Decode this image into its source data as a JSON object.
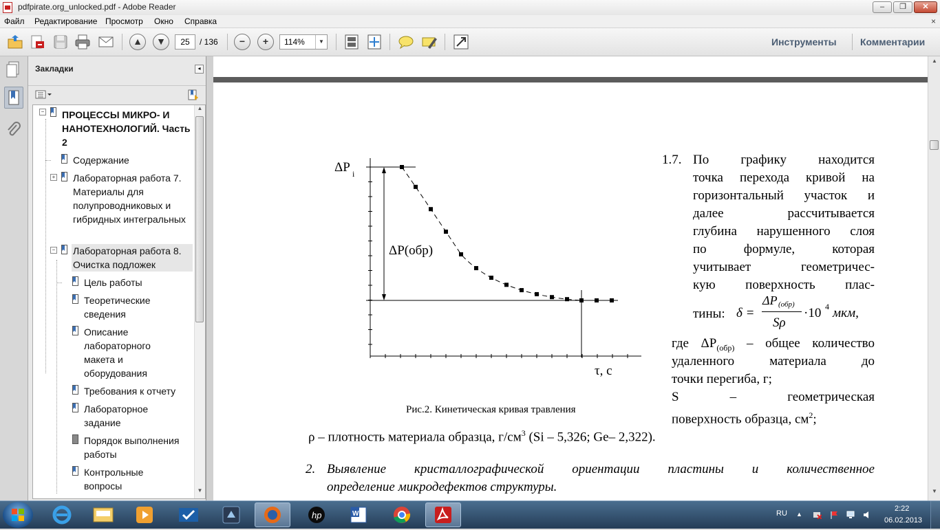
{
  "window": {
    "title": "pdfpirate.org_unlocked.pdf - Adobe Reader"
  },
  "menu": [
    "Файл",
    "Редактирование",
    "Просмотр",
    "Окно",
    "Справка"
  ],
  "toolbar": {
    "page_current": "25",
    "page_total": "/ 136",
    "zoom": "114%",
    "tools_label": "Инструменты",
    "comments_label": "Комментарии"
  },
  "bookmarks": {
    "title": "Закладки",
    "items": [
      {
        "label": "ПРОЦЕССЫ МИКРО- И НАНОТЕХНОЛОГИЙ. Часть 2"
      },
      {
        "label": "Содержание"
      },
      {
        "label": "Лабораторная работа 7. Материалы для полупроводниковых и гибридных интегральных"
      },
      {
        "label": "Лабораторная работа 8. Очистка подложек"
      },
      {
        "label": "Цель работы"
      },
      {
        "label": "Теоретические сведения"
      },
      {
        "label": "Описание лабораторного макета и оборудования"
      },
      {
        "label": "Требования к отчету"
      },
      {
        "label": "Лабораторное задание"
      },
      {
        "label": "Порядок выполнения работы"
      },
      {
        "label": "Контрольные вопросы"
      }
    ]
  },
  "document": {
    "figure": {
      "y_axis_label": "ΔP",
      "y_axis_sub": "i",
      "x_axis_label": "τ, с",
      "annotation": "ΔP(обр)",
      "caption": "Рис.2. Кинетическая кривая травления"
    },
    "item_17": {
      "number": "1.7.",
      "lines": [
        "По графику находится",
        "точка перехода кривой на",
        "горизонтальный участок и",
        "далее рассчитывается",
        "глубина нарушенного слоя",
        "по формуле, которая",
        "учитывает геометричес-",
        "кую поверхность плас-"
      ],
      "last_line_prefix": "тины:",
      "formula": {
        "lhs": "δ =",
        "numerator": "ΔP",
        "numerator_sub": "(обр)",
        "denominator": "Sρ",
        "factor": "·10",
        "exponent": "4",
        "unit": "мкм,"
      }
    },
    "where_lines": [
      {
        "pre": "где ΔP",
        "sub": "(обр)",
        "post": " – общее количество"
      },
      {
        "pre": "удаленного материала до"
      },
      {
        "pre": "точки перегиба, г;"
      },
      {
        "pre": "S – геометрическая"
      },
      {
        "pre": "поверхность образца, см",
        "sup": "2",
        "post": ";"
      }
    ],
    "rho_line": {
      "pre": "ρ – плотность материала образца, г/см",
      "sup": "3",
      "post": " (Si – 5,326; Ge– 2,322)."
    },
    "item_2": {
      "number": "2.",
      "line1": "Выявление кристаллографической ориентации пластины и количественное",
      "line2": "определение микродефектов структуры."
    }
  },
  "taskbar": {
    "lang": "RU",
    "time": "2:22",
    "date": "06.02.2013"
  }
}
